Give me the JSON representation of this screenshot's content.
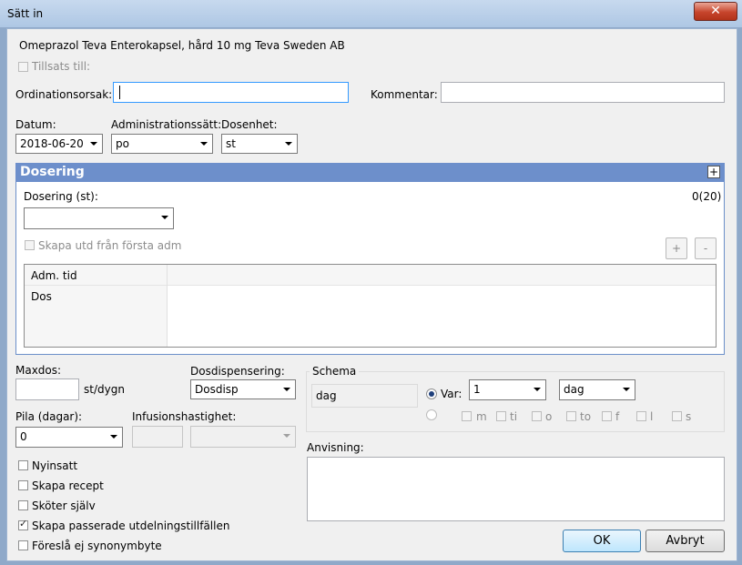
{
  "window": {
    "title": "Sätt in",
    "close_glyph": "✕"
  },
  "drug": {
    "name": "Omeprazol Teva Enterokapsel, hård 10 mg Teva Sweden AB"
  },
  "tillsats": {
    "label": "Tillsats till:",
    "checked": false
  },
  "ordinationsorsak": {
    "label": "Ordinationsorsak:",
    "value": ""
  },
  "kommentar": {
    "label": "Kommentar:",
    "value": ""
  },
  "datum": {
    "label": "Datum:",
    "value": "2018-06-20"
  },
  "administrationssatt": {
    "label": "Administrationssätt:",
    "value": "po"
  },
  "dosenhet": {
    "label": "Dosenhet:",
    "value": "st"
  },
  "dosering": {
    "title": "Dosering",
    "toggle": "+",
    "dose_label": "Dosering (st):",
    "dose_value": "",
    "count": "0(20)",
    "skapa_utd": "Skapa utd från första adm",
    "add_btn": "+",
    "remove_btn": "-",
    "grid": {
      "header": "Adm. tid",
      "row_label": "Dos"
    }
  },
  "maxdos": {
    "label": "Maxdos:",
    "value": "",
    "unit": "st/dygn"
  },
  "dosdispensering": {
    "label": "Dosdispensering:",
    "value": "Dosdisp"
  },
  "pila": {
    "label": "Pila (dagar):",
    "value": "0"
  },
  "infusion": {
    "label": "Infusionshastighet:",
    "value": "",
    "unit": ""
  },
  "schema": {
    "label": "Schema",
    "display": "dag",
    "var_label": "Var:",
    "interval": "1",
    "period": "dag",
    "weekdays": [
      "m",
      "ti",
      "o",
      "to",
      "f",
      "l",
      "s"
    ]
  },
  "checkboxes": [
    {
      "label": "Nyinsatt",
      "checked": false
    },
    {
      "label": "Skapa recept",
      "checked": false
    },
    {
      "label": "Sköter själv",
      "checked": false
    },
    {
      "label": "Skapa passerade utdelningstillfällen",
      "checked": true
    },
    {
      "label": "Föreslå ej synonymbyte",
      "checked": false
    }
  ],
  "anvisning": {
    "label": "Anvisning:",
    "value": ""
  },
  "buttons": {
    "ok": "OK",
    "cancel": "Avbryt"
  }
}
